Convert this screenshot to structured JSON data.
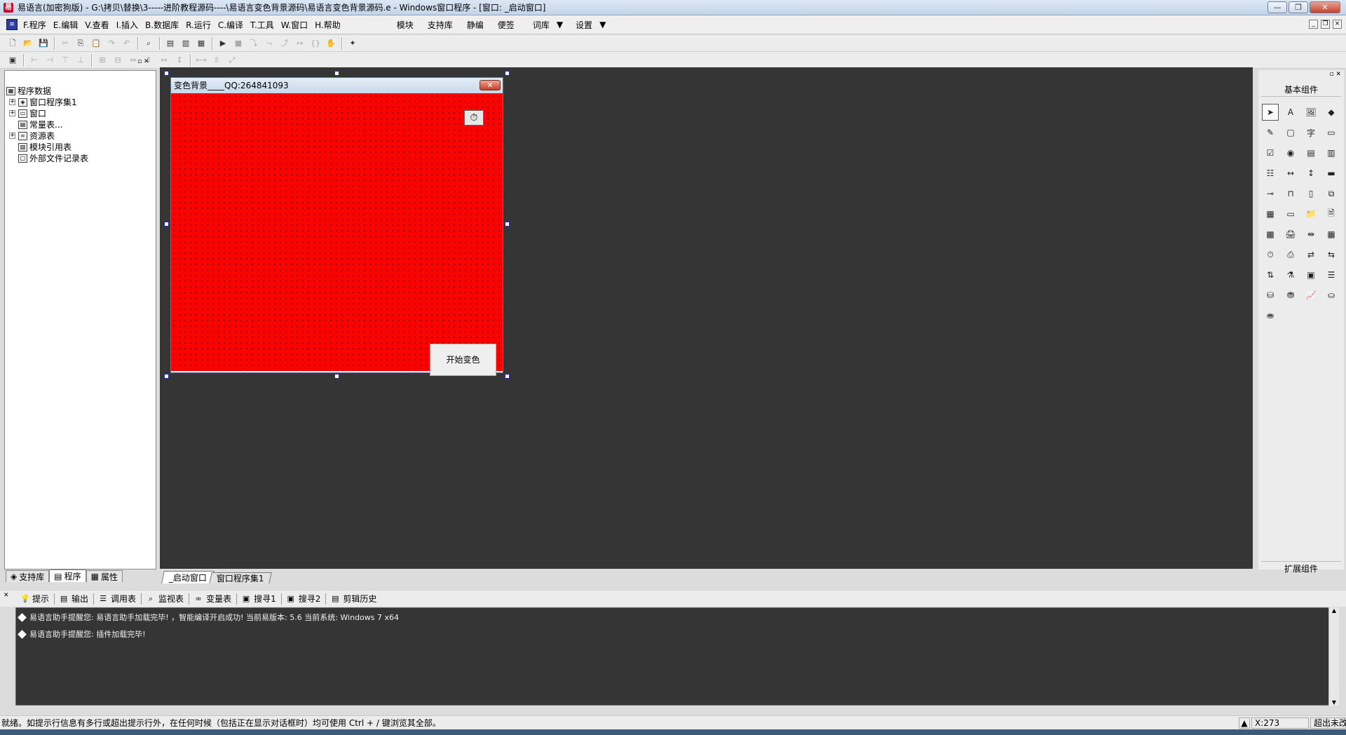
{
  "window": {
    "title": "易语言(加密狗版) - G:\\拷贝\\替换\\3-----进阶教程源码----\\易语言变色背景源码\\易语言变色背景源码.e - Windows窗口程序 - [窗口: _启动窗口]",
    "minimize_glyph": "—",
    "restore_glyph": "❐",
    "close_glyph": "✕"
  },
  "menu": {
    "items": [
      "F.程序",
      "E.编辑",
      "V.查看",
      "I.插入",
      "B.数据库",
      "R.运行",
      "C.编译",
      "T.工具",
      "W.窗口",
      "H.帮助"
    ],
    "extra": [
      "模块",
      "支持库",
      "静编",
      "便签",
      "词库",
      "设置"
    ]
  },
  "left_panel": {
    "tree": [
      {
        "label": "程序数据",
        "level": 0,
        "icon": "program-data-icon",
        "expander": ""
      },
      {
        "label": "窗口程序集1",
        "level": 1,
        "icon": "assembly-icon",
        "expander": "+"
      },
      {
        "label": "窗口",
        "level": 1,
        "icon": "window-icon",
        "expander": "+"
      },
      {
        "label": "常量表...",
        "level": 1,
        "icon": "constant-table-icon",
        "expander": ""
      },
      {
        "label": "资源表",
        "level": 1,
        "icon": "resource-table-icon",
        "expander": "+"
      },
      {
        "label": "模块引用表",
        "level": 1,
        "icon": "module-ref-icon",
        "expander": ""
      },
      {
        "label": "外部文件记录表",
        "level": 1,
        "icon": "external-file-icon",
        "expander": ""
      }
    ],
    "tabs": [
      "支持库",
      "程序",
      "属性"
    ]
  },
  "designer": {
    "form_title": "变色背景____QQ:264841093",
    "form_color": "#ff0000",
    "start_button": "开始变色",
    "tabs": [
      "_启动窗口",
      "窗口程序集1"
    ]
  },
  "components": {
    "header": "基本组件",
    "footer": "扩展组件"
  },
  "output_panel": {
    "tabs": [
      "提示",
      "输出",
      "调用表",
      "监视表",
      "变量表",
      "搜寻1",
      "搜寻2",
      "剪辑历史"
    ],
    "lines": [
      "易语言助手提醒您: 易语言助手加载完毕! ，智能编译开启成功! 当前易版本: 5.6 当前系统: Windows 7 x64",
      "易语言助手提醒您: 插件加载完毕!"
    ]
  },
  "status": {
    "message": "就绪。如提示行信息有多行或超出提示行外，在任何时候（包括正在显示对话框时）均可使用 Ctrl + / 键浏览其全部。",
    "coords": "X:273",
    "mode": "超出",
    "lock": "未改"
  }
}
